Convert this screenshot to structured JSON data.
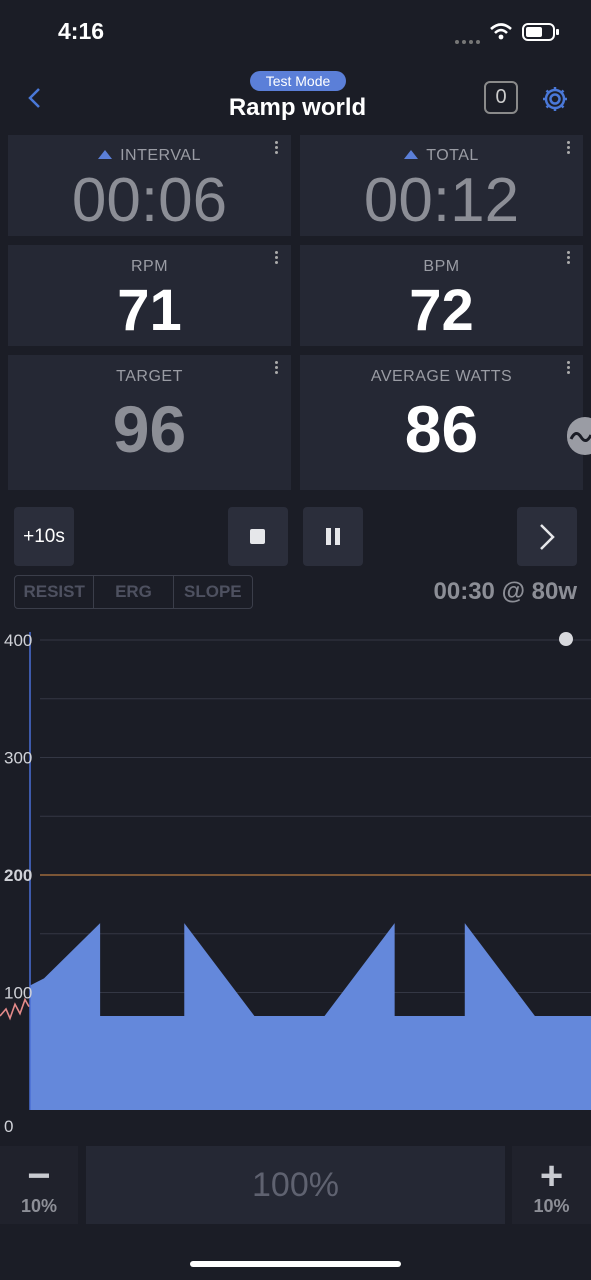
{
  "status_bar": {
    "time": "4:16"
  },
  "header": {
    "mode_badge": "Test Mode",
    "title": "Ramp world",
    "counter": "0"
  },
  "tiles": {
    "interval": {
      "label": "INTERVAL",
      "value": "00:06"
    },
    "total": {
      "label": "TOTAL",
      "value": "00:12"
    },
    "rpm": {
      "label": "RPM",
      "value": "71"
    },
    "bpm": {
      "label": "BPM",
      "value": "72"
    },
    "target": {
      "label": "TARGET",
      "value": "96"
    },
    "average_watts": {
      "label": "AVERAGE WATTS",
      "value": "86"
    }
  },
  "controls": {
    "add_time": "+10s",
    "modes": [
      "RESIST",
      "ERG",
      "SLOPE"
    ],
    "next_segment": "00:30 @ 80w"
  },
  "chart_data": {
    "type": "area",
    "y_ticks": [
      "400",
      "300",
      "200",
      "100",
      "0"
    ],
    "ylim": [
      0,
      400
    ],
    "threshold_line": 200,
    "x": [
      0,
      2,
      10,
      10,
      22,
      22,
      32,
      42,
      52,
      52,
      62,
      62,
      72,
      80
    ],
    "y": [
      106,
      112,
      159,
      80,
      80,
      159,
      80,
      80,
      159,
      80,
      80,
      159,
      80,
      80
    ],
    "colors": {
      "fill": "#6488db",
      "threshold": "#9c6a3c",
      "cursor": "#4a6fd6"
    }
  },
  "bottom": {
    "decrease_step": "10%",
    "intensity": "100%",
    "increase_step": "10%"
  }
}
